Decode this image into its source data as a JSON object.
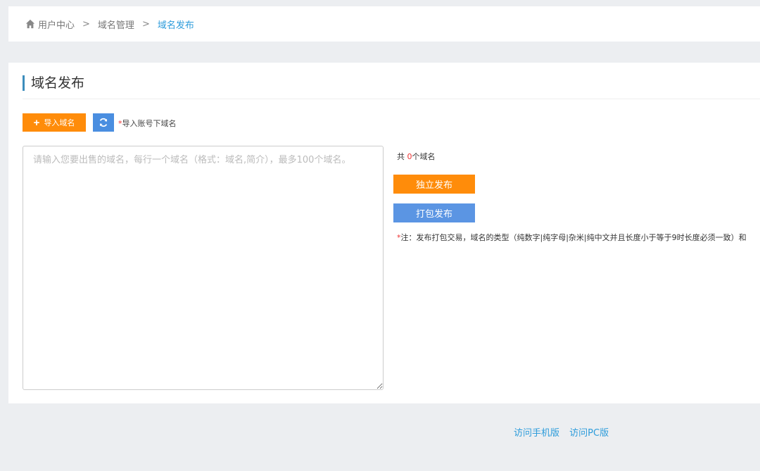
{
  "breadcrumb": {
    "home": "用户中心",
    "separator": ">",
    "manage": "域名管理",
    "current": "域名发布"
  },
  "panel": {
    "title": "域名发布",
    "import_label": "导入域名",
    "import_hint_star": "*",
    "import_hint": "导入账号下域名",
    "textarea_placeholder": "请输入您要出售的域名，每行一个域名（格式：域名,简介），最多100个域名。",
    "count_prefix": "共 ",
    "count_value": "0",
    "count_suffix": "个域名",
    "solo_publish": "独立发布",
    "pack_publish": "打包发布",
    "note_star": "*",
    "note": "注：发布打包交易，域名的类型（纯数字|纯字母|杂米|纯中文并且长度小于等于9时长度必须一致）和"
  },
  "footer": {
    "mobile": "访问手机版",
    "pc": "访问PC版"
  },
  "colors": {
    "orange": "#ff8c0a",
    "blue": "#5b95e3",
    "link": "#2d9cdb"
  }
}
